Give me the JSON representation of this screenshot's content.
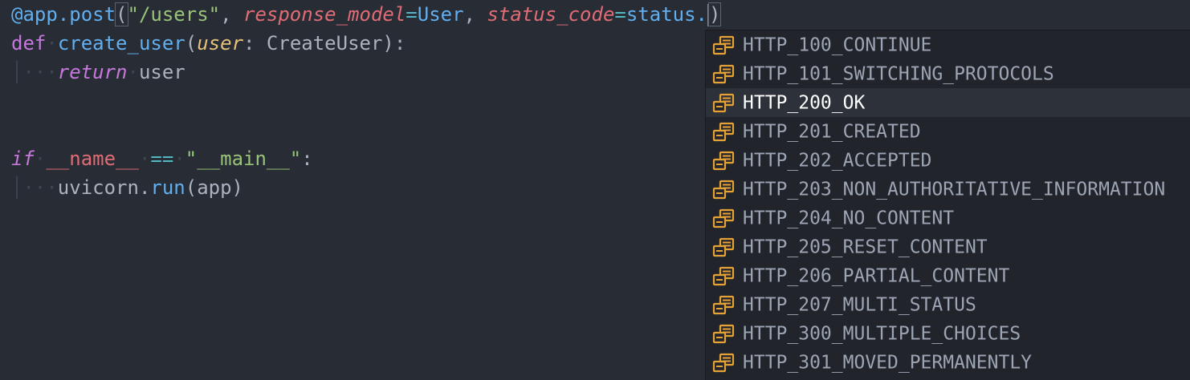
{
  "editor": {
    "line1": {
      "decorator": "@app.post",
      "open_paren": "(",
      "path": "\"/users\"",
      "comma1": ", ",
      "arg1_name": "response_model",
      "eq1": "=",
      "arg1_value": "User",
      "comma2": ", ",
      "arg2_name": "status_code",
      "eq2": "=",
      "arg2_value": "status.",
      "close_paren": ")"
    },
    "line2": {
      "kw": "def",
      "name": "create_user",
      "open": "(",
      "param": "user",
      "colon": ": ",
      "type": "CreateUser",
      "close": "):"
    },
    "line3": {
      "kw": "return",
      "value": "user"
    },
    "line6": {
      "kw": "if",
      "name": "__name__",
      "op": "==",
      "str": "\"__main__\"",
      "colon": ":"
    },
    "line7": {
      "obj": "uvicorn.",
      "fn": "run",
      "args": "(app)"
    }
  },
  "completion": {
    "selected_index": 2,
    "icon": "enum-member-icon",
    "items": [
      "HTTP_100_CONTINUE",
      "HTTP_101_SWITCHING_PROTOCOLS",
      "HTTP_200_OK",
      "HTTP_201_CREATED",
      "HTTP_202_ACCEPTED",
      "HTTP_203_NON_AUTHORITATIVE_INFORMATION",
      "HTTP_204_NO_CONTENT",
      "HTTP_205_RESET_CONTENT",
      "HTTP_206_PARTIAL_CONTENT",
      "HTTP_207_MULTI_STATUS",
      "HTTP_300_MULTIPLE_CHOICES",
      "HTTP_301_MOVED_PERMANENTLY"
    ]
  },
  "colors": {
    "background": "#282c34",
    "popup_background": "#21252b",
    "selected_row": "#2c313a",
    "icon_orange": "#e5a133"
  }
}
